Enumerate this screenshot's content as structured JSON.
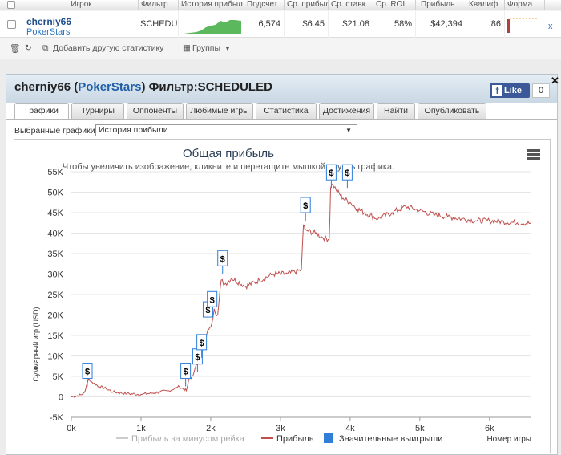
{
  "table": {
    "headers": [
      "Игрок",
      "Фильтр",
      "История прибыл",
      "Подсчет",
      "Ср. прибыль",
      "Ср. ставк.",
      "Ср. ROI",
      "Прибыль",
      "Квалиф",
      "Форма"
    ],
    "row": {
      "player": "cherniy66",
      "site": "PokerStars",
      "filter": "SCHEDUL",
      "count": "6,574",
      "avg_profit": "$6.45",
      "avg_stake": "$21.08",
      "avg_roi": "58%",
      "profit": "$42,394",
      "qualif": "86",
      "remove": "x"
    },
    "toolbar": {
      "add_stats": "Добавить другую статистику",
      "groups": "Группы"
    }
  },
  "panel": {
    "player": "cherniy66",
    "site": "PokerStars",
    "filter_label": "Фильтр:SCHEDULED",
    "fb_like": "Like",
    "fb_count": "0",
    "close": "✕",
    "tabs": [
      "Графики",
      "Турниры",
      "Оппоненты",
      "Любимые игры",
      "Статистика",
      "Достижения",
      "Найти",
      "Опубликовать"
    ],
    "selected_charts_label": "Выбранные графики:",
    "selected_chart": "История прибыли"
  },
  "chart_data": {
    "type": "line",
    "title": "Общая прибыль",
    "subtitle": "Чтобы увеличить изображение, кликните и перетащите мышкой внутрь графика.",
    "ylabel": "Суммарный игр (USD)",
    "xlabel": "Номер игры",
    "xlim": [
      0,
      6600
    ],
    "ylim": [
      -5000,
      55000
    ],
    "x_ticks": [
      "0k",
      "1k",
      "2k",
      "3k",
      "4k",
      "5k",
      "6k"
    ],
    "y_ticks": [
      "-5K",
      "0",
      "5K",
      "10K",
      "15K",
      "20K",
      "25K",
      "30K",
      "35K",
      "40K",
      "45K",
      "50K",
      "55K"
    ],
    "legend": [
      "Прибыль за минусом рейка",
      "Прибыль",
      "Значительные выигрыши"
    ],
    "colors": {
      "profit": "#c0504d",
      "rake": "#cccccc",
      "big_wins": "#2f7ed8"
    },
    "series": [
      {
        "name": "Прибыль",
        "x": [
          0,
          150,
          200,
          250,
          300,
          400,
          500,
          600,
          800,
          1000,
          1200,
          1400,
          1550,
          1650,
          1700,
          1720,
          1760,
          1800,
          1830,
          1870,
          1900,
          1960,
          2000,
          2050,
          2100,
          2150,
          2200,
          2300,
          2500,
          2700,
          2900,
          3100,
          3300,
          3330,
          3350,
          3400,
          3500,
          3600,
          3700,
          3720,
          3750,
          3800,
          3900,
          4000,
          4100,
          4200,
          4400,
          4600,
          4800,
          5000,
          5200,
          5400,
          5600,
          5800,
          6000,
          6200,
          6400,
          6600
        ],
        "y": [
          0,
          500,
          1500,
          4500,
          3500,
          2500,
          2000,
          1200,
          800,
          600,
          1000,
          1500,
          2500,
          1500,
          5000,
          4500,
          6000,
          8000,
          10000,
          12000,
          11500,
          16500,
          17000,
          21500,
          20000,
          28500,
          27500,
          29000,
          27000,
          28500,
          30000,
          30000,
          31000,
          42000,
          41000,
          40500,
          40000,
          39000,
          38500,
          51000,
          52000,
          50500,
          48500,
          47500,
          46000,
          45000,
          43500,
          45000,
          46500,
          45500,
          44500,
          44000,
          43500,
          43000,
          43000,
          42800,
          42500,
          42400
        ]
      }
    ],
    "big_wins": [
      {
        "x": 230,
        "y": 4500
      },
      {
        "x": 1640,
        "y": 4500
      },
      {
        "x": 1810,
        "y": 8000
      },
      {
        "x": 1870,
        "y": 11500
      },
      {
        "x": 1960,
        "y": 19500
      },
      {
        "x": 2020,
        "y": 22000
      },
      {
        "x": 2170,
        "y": 32000
      },
      {
        "x": 3360,
        "y": 45000
      },
      {
        "x": 3730,
        "y": 53000
      },
      {
        "x": 3960,
        "y": 53000
      }
    ]
  }
}
